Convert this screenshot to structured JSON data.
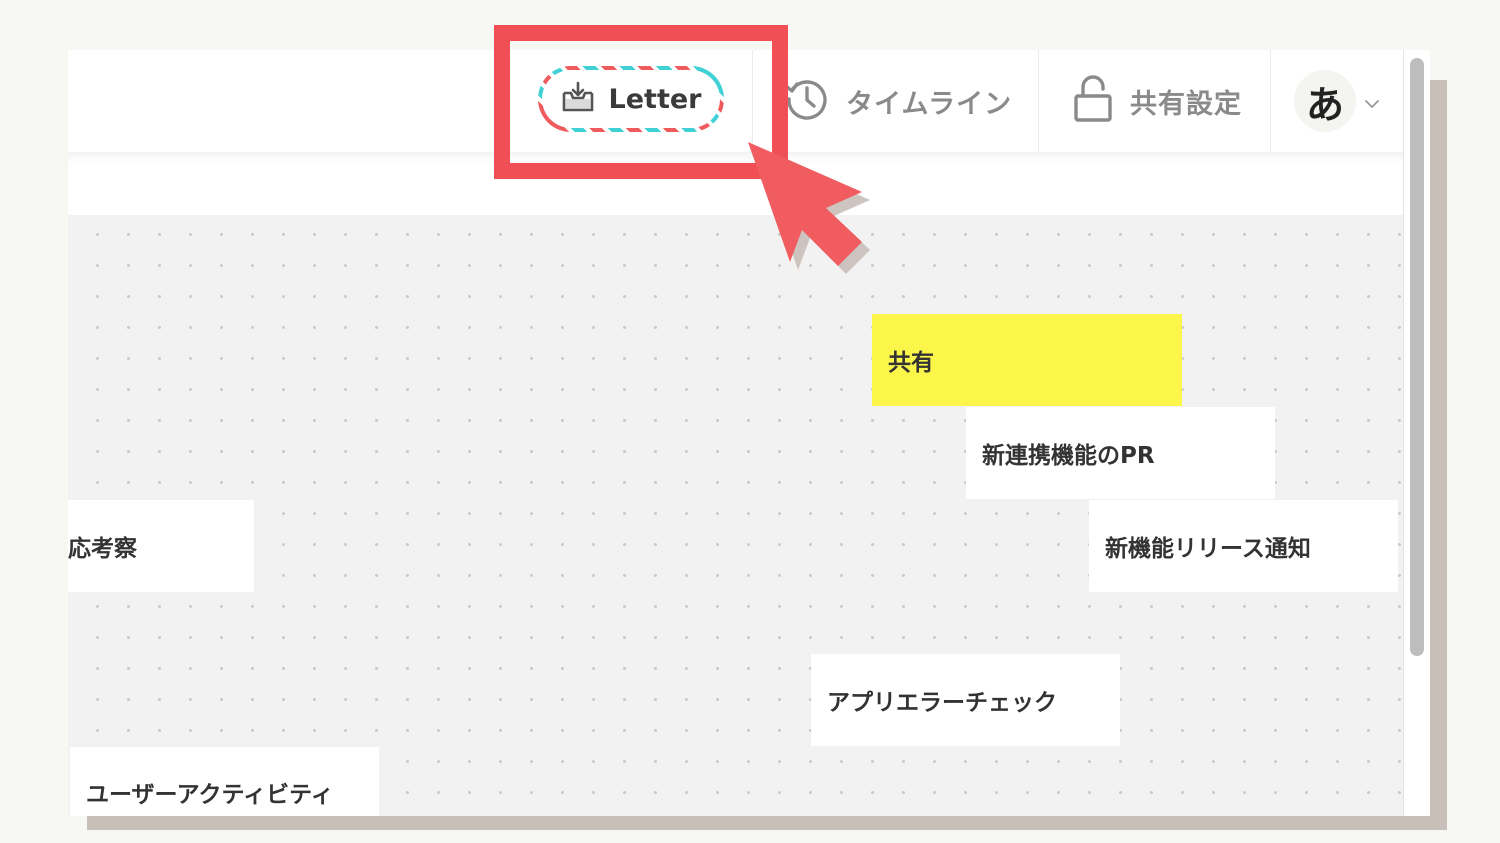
{
  "toolbar": {
    "letter_label": "Letter",
    "timeline_label": "タイムライン",
    "share_settings_label": "共有設定",
    "avatar_initial": "あ"
  },
  "cards": [
    {
      "label": "共有",
      "color": "#fdf64a"
    },
    {
      "label": "新連携機能のPR"
    },
    {
      "label": "応考察"
    },
    {
      "label": "新機能リリース通知"
    },
    {
      "label": "アプリエラーチェック"
    },
    {
      "label": "ユーザーアクティビティ"
    }
  ],
  "icons": [
    "inbox-download-icon",
    "clock-history-icon",
    "unlock-icon",
    "chevron-down-icon"
  ],
  "colors": {
    "highlight": "#ef4f55",
    "arrow": "#f05c5f",
    "letter_dash_teal": "#3fd1d6",
    "letter_dash_red": "#ef5a5c",
    "sticky_yellow": "#fdf64a"
  }
}
